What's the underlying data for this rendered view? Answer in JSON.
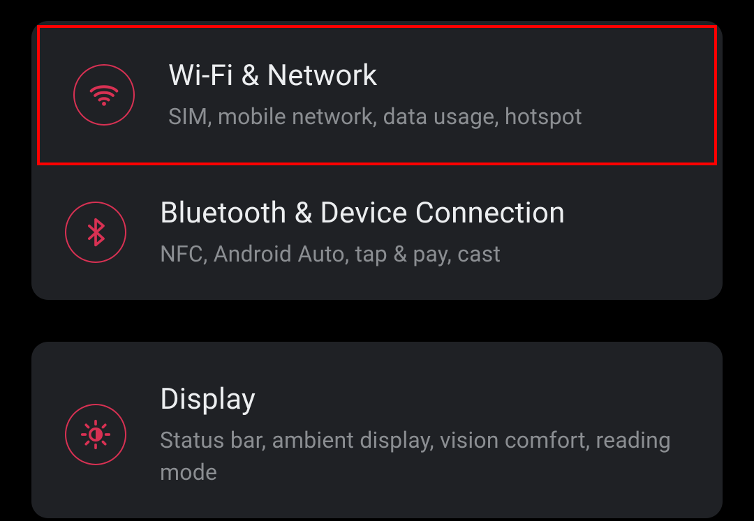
{
  "colors": {
    "accent": "#d83153",
    "card_bg": "#1f2125",
    "title_text": "#eceef0",
    "subtitle_text": "#8b8e92",
    "highlight": "#ff0000"
  },
  "settings": {
    "wifi": {
      "title": "Wi-Fi & Network",
      "subtitle": "SIM, mobile network, data usage, hotspot",
      "icon": "wifi-icon"
    },
    "bluetooth": {
      "title": "Bluetooth & Device Connection",
      "subtitle": "NFC, Android Auto, tap & pay, cast",
      "icon": "bluetooth-icon"
    },
    "display": {
      "title": "Display",
      "subtitle": "Status bar, ambient display, vision comfort, reading mode",
      "icon": "brightness-icon"
    }
  }
}
